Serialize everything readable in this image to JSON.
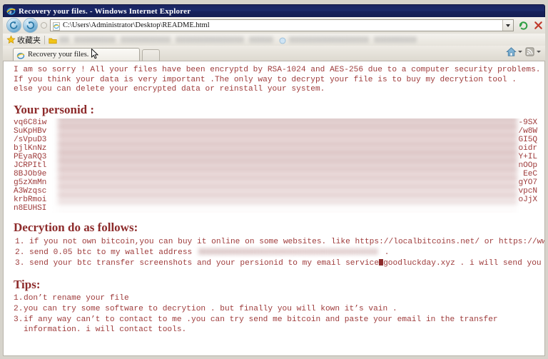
{
  "window": {
    "title": "Recovery your files. - Windows Internet Explorer",
    "ie_icon": "internet-explorer-icon"
  },
  "navbar": {
    "back_glyph": "◀",
    "forward_glyph": "▶",
    "address_value": "C:\\Users\\Administrator\\Desktop\\README.html",
    "address_placeholder": "",
    "refresh_icon": "refresh-icon",
    "stop_icon": "stop-icon",
    "page_icon": "page-icon"
  },
  "favorites_bar": {
    "label": "收藏夹",
    "star_icon": "star-icon"
  },
  "tabs": [
    {
      "title": "Recovery your files.",
      "icon": "internet-explorer-icon",
      "active": true
    }
  ],
  "tabbar_right": {
    "home_icon": "home-icon",
    "feeds_icon": "rss-feed-icon"
  },
  "page": {
    "intro": [
      "I am so sorry ! All your files have been encryptd by RSA-1024 and AES-256 due to a computer security problems.",
      "If you think your data is very important .The only way to decrypt your file is to buy my decrytion tool .",
      "else you can delete your encrypted data or reinstall your system."
    ],
    "personid_heading": "Your personid :",
    "personid_lines": [
      {
        "prefix": "vq6C8iw",
        "suffix": "-9SX"
      },
      {
        "prefix": "SuKpHBv",
        "suffix": "/w8W"
      },
      {
        "prefix": "/sVpuD3",
        "suffix": "GI5Q"
      },
      {
        "prefix": "bjlKnNz",
        "suffix": "oidr"
      },
      {
        "prefix": "PEyaRQ3",
        "suffix": "Y+IL"
      },
      {
        "prefix": "JCRPItl",
        "suffix": "nOOp"
      },
      {
        "prefix": "8BJOb9e",
        "suffix": "EeC"
      },
      {
        "prefix": "g5zXmMn",
        "suffix": "gYO7"
      },
      {
        "prefix": "A3Wzqsc",
        "suffix": "vpcN"
      },
      {
        "prefix": "krbRmoi",
        "suffix": "oJjX"
      },
      {
        "prefix": "n8EUHSI",
        "suffix": ""
      }
    ],
    "decryption_heading": "Decrytion do as follows:",
    "steps": [
      {
        "before": "if you not own bitcoin,you can buy it online on some websites. like https://localbitcoins.net/ or https://www.coinbase.com/ .",
        "after": "",
        "redacted": false
      },
      {
        "before": "send 0.05 btc to my wallet address",
        "after": ".",
        "redacted": true
      },
      {
        "before": "send your btc transfer screenshots and your persionid to my email service",
        "after": "goodluckday.xyz . i will send you decrytion tool.",
        "redacted": false,
        "at_symbol": true
      }
    ],
    "tips_heading": "Tips:",
    "tips": [
      "don’t rename your file",
      "you can try some software to decrytion . but finally you will kown it’s vain .",
      "if any way can’t to contact to me .you can try send me bitcoin and paste your email in the transfer information. i will contact tools."
    ]
  },
  "colors": {
    "titlebar": "#1b2460",
    "body_text": "#9e3b3b",
    "heading": "#8d2b2b",
    "page_bg": "#ffffff",
    "chrome_bg": "#d6d3cb"
  }
}
